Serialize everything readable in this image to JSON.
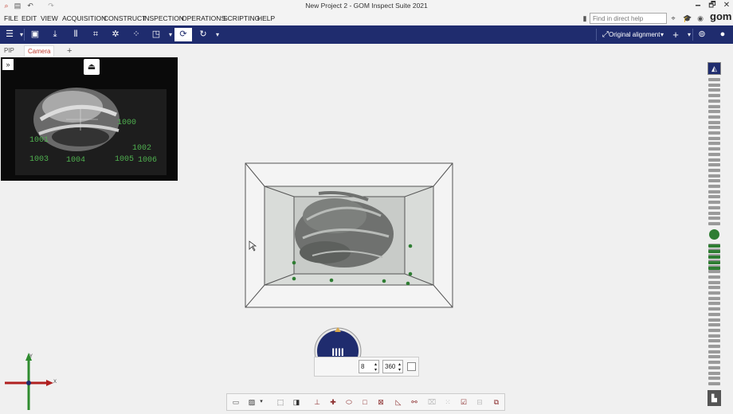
{
  "window": {
    "title": "New Project 2 - GOM Inspect Suite 2021",
    "controls": [
      "🗕",
      "🗗",
      "✕"
    ]
  },
  "quick_access": [
    "⌕",
    "▤",
    "↶",
    "↷"
  ],
  "menu": [
    "FILE",
    "EDIT",
    "VIEW",
    "ACQUISITION",
    "CONSTRUCT",
    "INSPECTION",
    "OPERATIONS",
    "SCRIPTING",
    "HELP"
  ],
  "help_search": {
    "placeholder": "Find in direct help"
  },
  "brand": "gom",
  "toolbar": {
    "alignment_label": "Original alignment",
    "icons": [
      "menu-icon",
      "layout-icon",
      "import-icon",
      "scan-bars-icon",
      "crop-icon",
      "target-icon",
      "points-icon",
      "frame-icon",
      "refresh-icon",
      "redo-icon"
    ]
  },
  "tabs": {
    "pip": "PIP",
    "camera": "Camera",
    "add": "+"
  },
  "pip": {
    "expand": "»",
    "points": [
      {
        "label": "1000"
      },
      {
        "label": "1001"
      },
      {
        "label": "1002"
      },
      {
        "label": "1003"
      },
      {
        "label": "1004"
      },
      {
        "label": "1005"
      },
      {
        "label": "1006"
      }
    ]
  },
  "rotation": {
    "steps": "8",
    "degrees": "360",
    "button_glyph": "IIII"
  },
  "axes": {
    "x": "X",
    "y": "Y"
  },
  "colors": {
    "toolbar": "#1f2c6e",
    "accent": "#c0392b",
    "marker": "#2e7d32",
    "turntable": "#1f2c6e"
  }
}
